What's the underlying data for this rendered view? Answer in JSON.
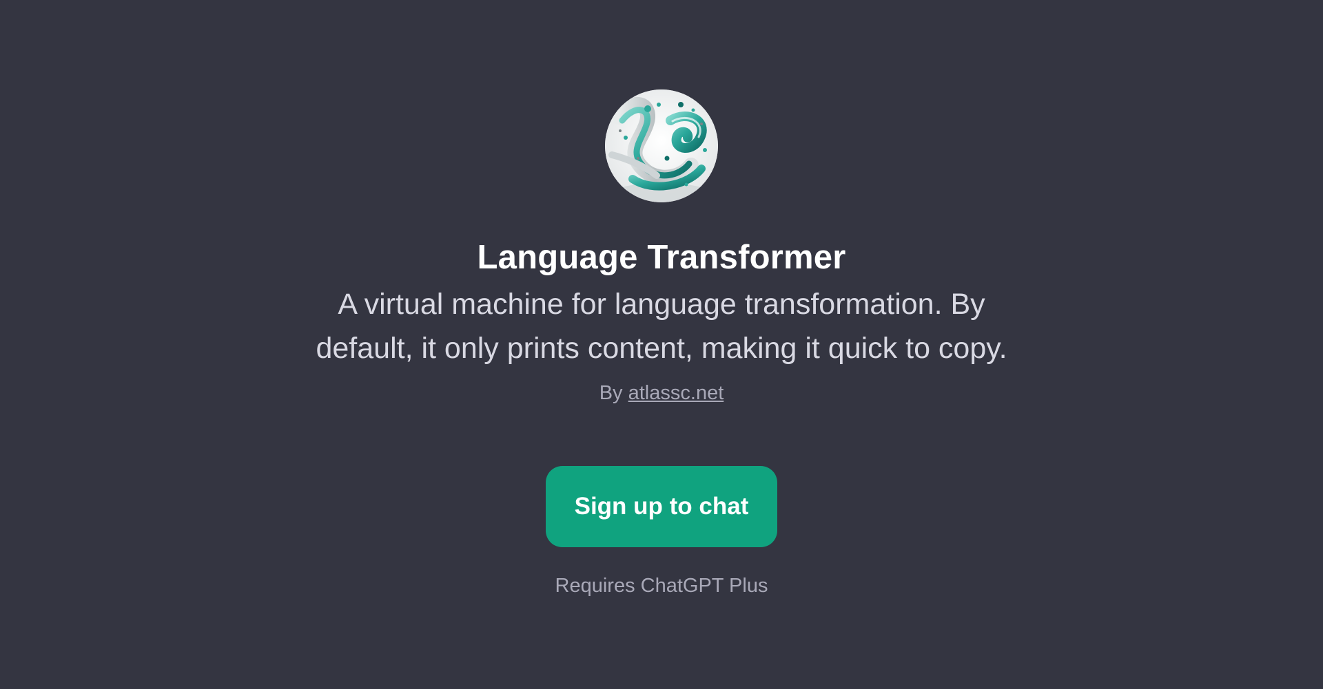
{
  "gpt": {
    "name": "Language Transformer",
    "description": "A virtual machine for language transformation. By default, it only prints content, making it quick to copy.",
    "author_prefix": "By",
    "author_name": "atlassc.net",
    "avatar_icon": "swirl-artwork-avatar"
  },
  "actions": {
    "signup_label": "Sign up to chat"
  },
  "footer": {
    "requirement": "Requires ChatGPT Plus"
  },
  "colors": {
    "background": "#343541",
    "accent": "#10a37f",
    "title": "#ffffff",
    "muted": "#a9a9b8"
  }
}
